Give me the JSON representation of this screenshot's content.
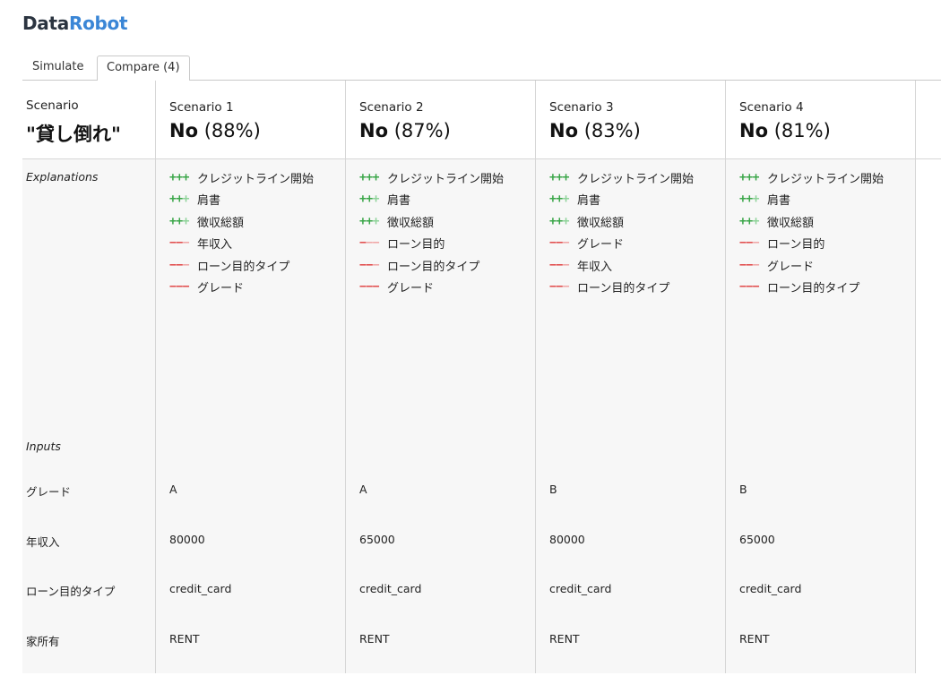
{
  "logo": {
    "part1": "Data",
    "part2": "Robot"
  },
  "tabs": {
    "simulate": "Simulate",
    "compare": "Compare (4)"
  },
  "label_column": {
    "header_small": "Scenario",
    "header_big": "\"貸し倒れ\"",
    "explanations": "Explanations",
    "inputs": "Inputs",
    "rows": [
      "グレード",
      "年収入",
      "ローン目的タイプ",
      "家所有"
    ]
  },
  "scenarios": [
    {
      "name": "Scenario 1",
      "prediction": "No",
      "probability": "(88%)",
      "explanations": [
        {
          "sign": "+++",
          "strength": 3,
          "text": "クレジットライン開始"
        },
        {
          "sign": "+++",
          "strength": 2,
          "text": "肩書"
        },
        {
          "sign": "+++",
          "strength": 2,
          "text": "徴収総額"
        },
        {
          "sign": "---",
          "strength": 2,
          "text": "年収入"
        },
        {
          "sign": "---",
          "strength": 2,
          "text": "ローン目的タイプ"
        },
        {
          "sign": "---",
          "strength": 3,
          "text": "グレード"
        }
      ],
      "inputs": [
        "A",
        "80000",
        "credit_card",
        "RENT"
      ]
    },
    {
      "name": "Scenario 2",
      "prediction": "No",
      "probability": "(87%)",
      "explanations": [
        {
          "sign": "+++",
          "strength": 3,
          "text": "クレジットライン開始"
        },
        {
          "sign": "+++",
          "strength": 2,
          "text": "肩書"
        },
        {
          "sign": "+++",
          "strength": 2,
          "text": "徴収総額"
        },
        {
          "sign": "---",
          "strength": 1,
          "text": "ローン目的"
        },
        {
          "sign": "---",
          "strength": 2,
          "text": "ローン目的タイプ"
        },
        {
          "sign": "---",
          "strength": 3,
          "text": "グレード"
        }
      ],
      "inputs": [
        "A",
        "65000",
        "credit_card",
        "RENT"
      ]
    },
    {
      "name": "Scenario 3",
      "prediction": "No",
      "probability": "(83%)",
      "explanations": [
        {
          "sign": "+++",
          "strength": 3,
          "text": "クレジットライン開始"
        },
        {
          "sign": "+++",
          "strength": 2,
          "text": "肩書"
        },
        {
          "sign": "+++",
          "strength": 2,
          "text": "徴収総額"
        },
        {
          "sign": "---",
          "strength": 2,
          "text": "グレード"
        },
        {
          "sign": "---",
          "strength": 2,
          "text": "年収入"
        },
        {
          "sign": "---",
          "strength": 2,
          "text": "ローン目的タイプ"
        }
      ],
      "inputs": [
        "B",
        "80000",
        "credit_card",
        "RENT"
      ]
    },
    {
      "name": "Scenario 4",
      "prediction": "No",
      "probability": "(81%)",
      "explanations": [
        {
          "sign": "+++",
          "strength": 3,
          "text": "クレジットライン開始"
        },
        {
          "sign": "+++",
          "strength": 2,
          "text": "肩書"
        },
        {
          "sign": "+++",
          "strength": 2,
          "text": "徴収総額"
        },
        {
          "sign": "---",
          "strength": 2,
          "text": "ローン目的"
        },
        {
          "sign": "---",
          "strength": 2,
          "text": "グレード"
        },
        {
          "sign": "---",
          "strength": 3,
          "text": "ローン目的タイプ"
        }
      ],
      "inputs": [
        "B",
        "65000",
        "credit_card",
        "RENT"
      ]
    }
  ],
  "colors": {
    "positive": "#3aa648",
    "positive_light": "#8fd39a",
    "negative": "#e04848",
    "negative_light": "#f0a3a3",
    "brand_blue": "#3a86d6"
  }
}
